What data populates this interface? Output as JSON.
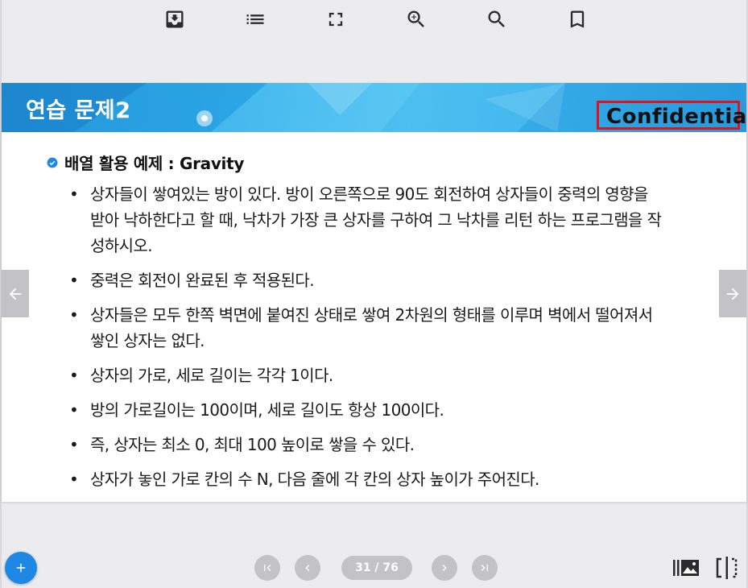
{
  "toolbar": {
    "icons": [
      "download-icon",
      "list-icon",
      "fullscreen-icon",
      "zoom-in-icon",
      "search-icon",
      "bookmark-icon"
    ]
  },
  "slide": {
    "title": "연습 문제2",
    "confidential_label": "Confidential",
    "heading": "배열 활용 예제 : Gravity",
    "bullet_symbol": "•",
    "bullets": [
      "상자들이 쌓여있는 방이 있다. 방이 오른쪽으로 90도 회전하여 상자들이 중력의 영향을 받아 낙하한다고 할 때, 낙차가 가장 큰 상자를 구하여 그 낙차를 리턴 하는 프로그램을 작성하시오.",
      " 중력은 회전이 완료된 후 적용된다.",
      " 상자들은 모두 한쪽 벽면에 붙여진 상태로 쌓여 2차원의 형태를 이루며 벽에서 떨어져서 쌓인 상자는 없다.",
      "상자의 가로, 세로 길이는 각각 1이다.",
      " 방의 가로길이는 100이며, 세로 길이도 항상 100이다.",
      " 즉, 상자는 최소 0, 최대 100 높이로 쌓을 수 있다.",
      "상자가 놓인 가로 칸의 수 N, 다음 줄에 각 칸의 상자 높이가 주어진다."
    ],
    "colors": {
      "header_blue": "#2aa8e8",
      "confidential_border": "#e0141b"
    }
  },
  "pager": {
    "current_page": 31,
    "total_pages": 76,
    "label": "31 / 76"
  },
  "colors": {
    "fab": "#1e88e5",
    "nav_gray": "#c3c3c7",
    "background": "#ececee"
  }
}
